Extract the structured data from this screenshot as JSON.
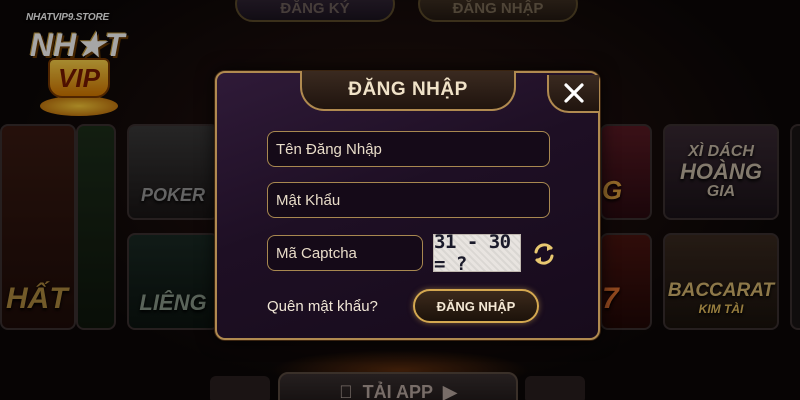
{
  "background": {
    "top_tabs": {
      "register": "ĐĂNG KÝ",
      "login": "ĐĂNG NHẬP"
    },
    "logo": {
      "site": "NHATVIP9.STORE",
      "word": "NH★T",
      "vip": "VIP"
    },
    "games": {
      "left_card": "HẤT",
      "poker": "POKER",
      "lieng": "LIÊNG",
      "xidach": {
        "line1": "XÌ DÁCH",
        "line2": "HOÀNG",
        "line3": "GIA"
      },
      "baccarat": {
        "line1": "BACCARAT",
        "line2": "KIM TÀI"
      },
      "right1": "G",
      "right2": "7"
    },
    "bottom_bar": {
      "label": "TẢI APP"
    }
  },
  "modal": {
    "title": "ĐĂNG NHẬP",
    "username_placeholder": "Tên Đăng Nhập",
    "password_placeholder": "Mật Khẩu",
    "captcha_placeholder": "Mã Captcha",
    "captcha_text": "31 - 30 = ?",
    "forgot_label": "Quên mật khẩu?",
    "submit_label": "ĐĂNG NHẬP"
  },
  "colors": {
    "accent_gold": "#b08a50",
    "modal_bg": "#1e0f24",
    "refresh_icon": "#e8c870"
  }
}
